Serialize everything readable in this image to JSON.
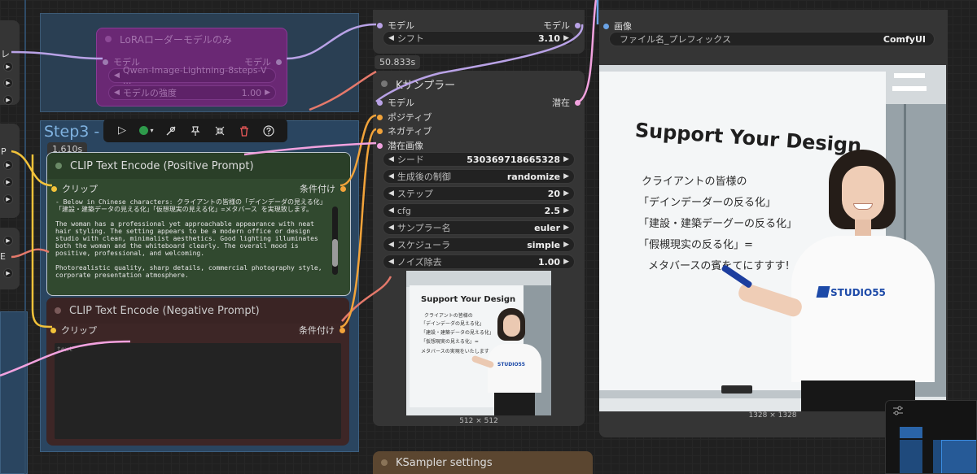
{
  "stub_labels": {
    "left_top": "レ",
    "left_p": "P",
    "left_e": "E"
  },
  "lora_group": {
    "title": "LoRAローダーモデルのみ",
    "in_label": "モデル",
    "out_label": "モデル",
    "lora_name": "Qwen-Image-Lightning-8steps-V ...",
    "strength_label": "モデルの強度",
    "strength_value": "1.00"
  },
  "step3_group": {
    "title": "Step3 - F"
  },
  "toolbar": {
    "icons": [
      "play-icon",
      "color-dot-icon",
      "bypass-icon",
      "pin-icon",
      "collapse-icon",
      "delete-icon",
      "help-icon"
    ]
  },
  "clip_pos": {
    "badge": "1.610s",
    "title": "CLIP Text Encode (Positive Prompt)",
    "in_label": "クリップ",
    "out_label": "条件付け",
    "text": "- Below in Chinese characters: クライアントの皆様の「デインデーダの見える化」「建設・建築データの見える化」「仮想現実の見える化」=メタバース を実現致します。\n\nThe woman has a professional yet approachable appearance with neat hair styling. The setting appears to be a modern office or design studio with clean, minimalist aesthetics. Good lighting illuminates both the woman and the whiteboard clearly. The overall mood is positive, professional, and welcoming.\n\nPhotorealistic quality, sharp details, commercial photography style, corporate presentation atmosphere."
  },
  "clip_neg": {
    "title": "CLIP Text Encode (Negative Prompt)",
    "in_label": "クリップ",
    "out_label": "条件付け",
    "placeholder": "text"
  },
  "shift_node": {
    "in_label": "モデル",
    "out_label": "モデル",
    "shift_label": "シフト",
    "shift_value": "3.10"
  },
  "ksampler": {
    "badge": "50.833s",
    "title": "Kサンプラー",
    "inputs": [
      "モデル",
      "ポジティブ",
      "ネガティブ",
      "潜在画像"
    ],
    "output": "潜在",
    "widgets": [
      {
        "label": "シード",
        "value": "530369718665328"
      },
      {
        "label": "生成後の制御",
        "value": "randomize"
      },
      {
        "label": "ステップ",
        "value": "20"
      },
      {
        "label": "cfg",
        "value": "2.5"
      },
      {
        "label": "サンプラー名",
        "value": "euler"
      },
      {
        "label": "スケジューラ",
        "value": "simple"
      },
      {
        "label": "ノイズ除去",
        "value": "1.00"
      }
    ],
    "preview_size": "512 × 512",
    "preview": {
      "heading": "Support Your Design",
      "lines": [
        "クライアントの皆様の",
        "「デインデーダの見える化」",
        "「建設・建築データの見える化」",
        "「仮想現実の見える化」=",
        "メタバースの実現をいたします"
      ],
      "shirt": "STUDIO55"
    }
  },
  "save_node": {
    "in_label": "画像",
    "prefix_label": "ファイル名_プレフィックス",
    "prefix_value": "ComfyUI",
    "size": "1328 × 1328",
    "image": {
      "heading": "Support Your Design",
      "lines": [
        "クライアントの皆様の",
        "「デインデーダーの反る化」",
        "「建設・建築デーグーの反る化」",
        "「假槻現实の反る化」=",
        "メタバースの賓をてにすすす!"
      ],
      "shirt": "STUDIO55"
    }
  },
  "ksampler_settings": {
    "title": "KSampler settings"
  },
  "colors": {
    "lora_purple": "#7d2f86",
    "positive_green": "#2f4a2d",
    "negative_red": "#3e2727",
    "group_blue": "#2e4f6b",
    "wire_purple": "#b9a2e6",
    "wire_orange": "#f2a33a",
    "wire_pink": "#f2a2df",
    "wire_red": "#e5796b",
    "wire_yellow": "#f2c23a"
  }
}
